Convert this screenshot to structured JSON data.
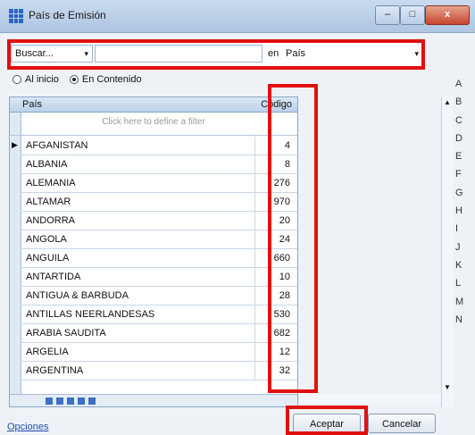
{
  "window": {
    "title": "País de Emisión",
    "close_glyph": "x",
    "minimize_glyph": "–",
    "maximize_glyph": "□"
  },
  "search": {
    "mode_selected": "Buscar...",
    "input_value": "",
    "in_label": "en",
    "field_selected": "País"
  },
  "search_options": {
    "option_start": "Al inicio",
    "option_content": "En Contenido",
    "selected": "En Contenido"
  },
  "grid": {
    "columns": [
      "País",
      "Código"
    ],
    "filter_placeholder": "Click here to define a filter",
    "rows": [
      {
        "pais": "AFGANISTAN",
        "codigo": "4"
      },
      {
        "pais": "ALBANIA",
        "codigo": "8"
      },
      {
        "pais": "ALEMANIA",
        "codigo": "276"
      },
      {
        "pais": "ALTAMAR",
        "codigo": "970"
      },
      {
        "pais": "ANDORRA",
        "codigo": "20"
      },
      {
        "pais": "ANGOLA",
        "codigo": "24"
      },
      {
        "pais": "ANGUILA",
        "codigo": "660"
      },
      {
        "pais": "ANTARTIDA",
        "codigo": "10"
      },
      {
        "pais": "ANTIGUA & BARBUDA",
        "codigo": "28"
      },
      {
        "pais": "ANTILLAS NEERLANDESAS",
        "codigo": "530"
      },
      {
        "pais": "ARABIA SAUDITA",
        "codigo": "682"
      },
      {
        "pais": "ARGELIA",
        "codigo": "12"
      },
      {
        "pais": "ARGENTINA",
        "codigo": "32"
      }
    ]
  },
  "alphabet": [
    "A",
    "B",
    "C",
    "D",
    "E",
    "F",
    "G",
    "H",
    "I",
    "J",
    "K",
    "L",
    "M",
    "N"
  ],
  "footer": {
    "options_link": "Opciones",
    "ok_label": "Aceptar",
    "cancel_label": "Cancelar"
  },
  "icons": {
    "grid_indicator": "triangle-right-icon",
    "scroll_up": "up-arrow-icon",
    "scroll_down": "down-arrow-icon"
  },
  "colors": {
    "highlight": "#e01010",
    "link": "#1f4fae"
  }
}
